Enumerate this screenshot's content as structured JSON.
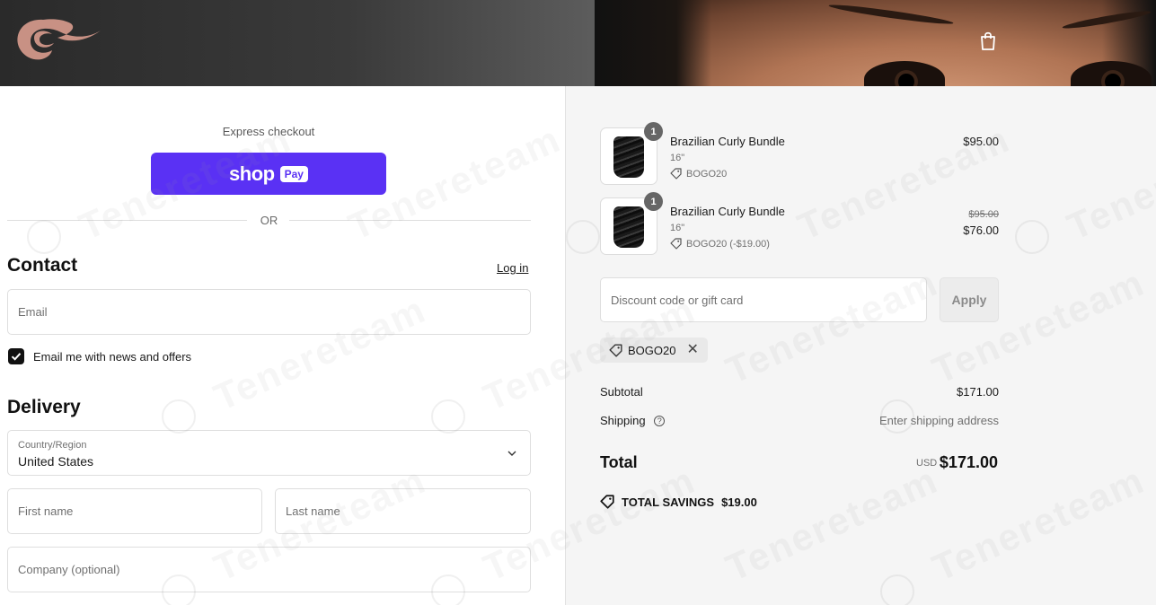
{
  "header": {
    "logo_icon": "brand-wave-logo",
    "cart_icon": "shopping-bag-icon"
  },
  "checkout": {
    "express_title": "Express checkout",
    "shop_pay": {
      "word": "shop",
      "badge": "Pay"
    },
    "or_text": "OR",
    "contact": {
      "heading": "Contact",
      "login_link": "Log in",
      "email_placeholder": "Email",
      "newsletter_label": "Email me with news and offers",
      "newsletter_checked": true
    },
    "delivery": {
      "heading": "Delivery",
      "country_label": "Country/Region",
      "country_value": "United States",
      "first_name_placeholder": "First name",
      "last_name_placeholder": "Last name",
      "company_placeholder": "Company (optional)"
    }
  },
  "summary": {
    "items": [
      {
        "quantity": "1",
        "name": "Brazilian Curly Bundle",
        "variant": "16\"",
        "discount": "BOGO20",
        "price": "$95.00"
      },
      {
        "quantity": "1",
        "name": "Brazilian Curly Bundle",
        "variant": "16\"",
        "discount": "BOGO20 (-$19.00)",
        "original_price": "$95.00",
        "price": "$76.00"
      }
    ],
    "discount_placeholder": "Discount code or gift card",
    "apply_label": "Apply",
    "applied_code": "BOGO20",
    "subtotal_label": "Subtotal",
    "subtotal_value": "$171.00",
    "shipping_label": "Shipping",
    "shipping_value": "Enter shipping address",
    "total_label": "Total",
    "total_currency": "USD",
    "total_value": "$171.00",
    "savings_label": "TOTAL SAVINGS",
    "savings_value": "$19.00"
  },
  "watermark": "Tenereteam",
  "colors": {
    "shop_pay_purple": "#5a31f4",
    "summary_bg": "#f5f5f5",
    "text_primary": "#1a1a1a"
  }
}
